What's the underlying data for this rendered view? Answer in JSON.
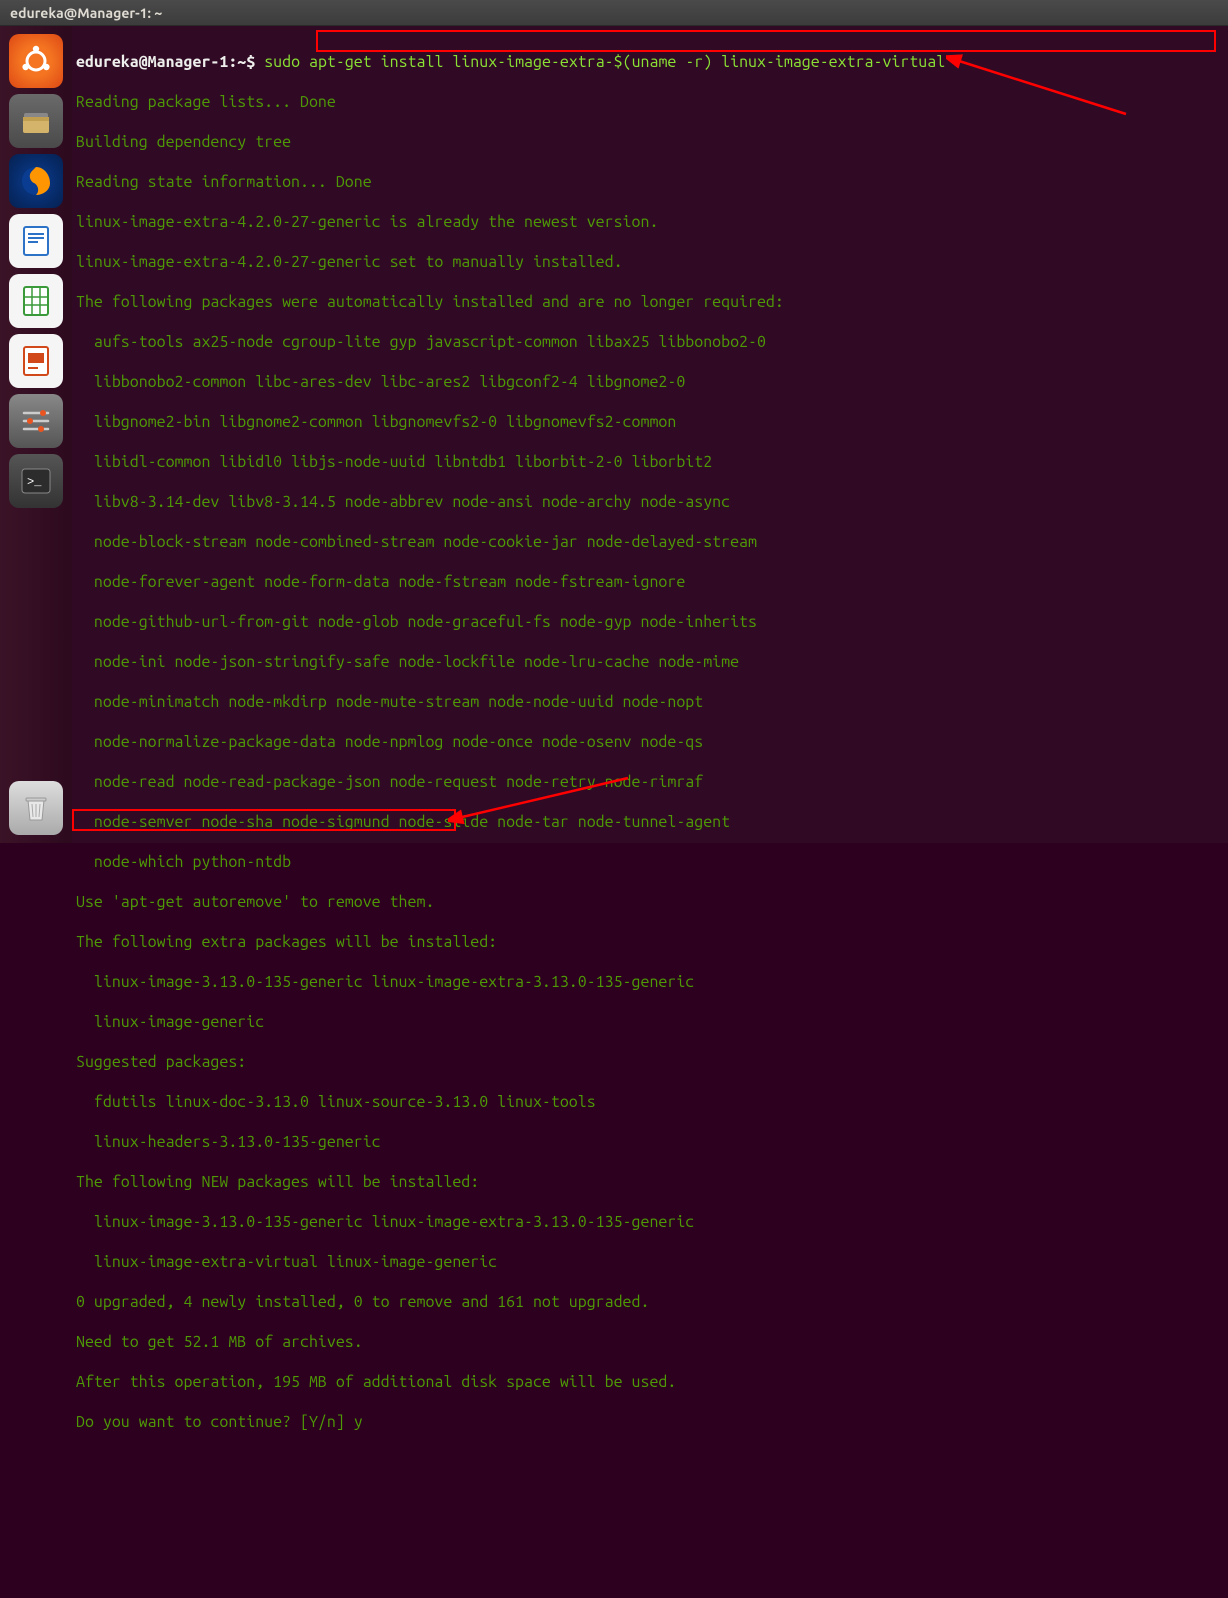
{
  "window": {
    "title": "edureka@Manager-1: ~"
  },
  "launcher": {
    "items": [
      {
        "name": "ubuntu-dash"
      },
      {
        "name": "files"
      },
      {
        "name": "firefox"
      },
      {
        "name": "libreoffice-writer"
      },
      {
        "name": "libreoffice-calc"
      },
      {
        "name": "libreoffice-impress"
      },
      {
        "name": "system-settings"
      },
      {
        "name": "terminal"
      },
      {
        "name": "trash"
      }
    ]
  },
  "terminal": {
    "prompt_user_host": "edureka@Manager-1",
    "prompt_path": "~",
    "prompt_sep": ":",
    "prompt_dollar": "$",
    "command": "sudo apt-get install linux-image-extra-$(uname -r) linux-image-extra-virtual",
    "lines": [
      "Reading package lists... Done",
      "Building dependency tree",
      "Reading state information... Done",
      "linux-image-extra-4.2.0-27-generic is already the newest version.",
      "linux-image-extra-4.2.0-27-generic set to manually installed.",
      "The following packages were automatically installed and are no longer required:",
      "  aufs-tools ax25-node cgroup-lite gyp javascript-common libax25 libbonobo2-0",
      "  libbonobo2-common libc-ares-dev libc-ares2 libgconf2-4 libgnome2-0",
      "  libgnome2-bin libgnome2-common libgnomevfs2-0 libgnomevfs2-common",
      "  libidl-common libidl0 libjs-node-uuid libntdb1 liborbit-2-0 liborbit2",
      "  libv8-3.14-dev libv8-3.14.5 node-abbrev node-ansi node-archy node-async",
      "  node-block-stream node-combined-stream node-cookie-jar node-delayed-stream",
      "  node-forever-agent node-form-data node-fstream node-fstream-ignore",
      "  node-github-url-from-git node-glob node-graceful-fs node-gyp node-inherits",
      "  node-ini node-json-stringify-safe node-lockfile node-lru-cache node-mime",
      "  node-minimatch node-mkdirp node-mute-stream node-node-uuid node-nopt",
      "  node-normalize-package-data node-npmlog node-once node-osenv node-qs",
      "  node-read node-read-package-json node-request node-retry node-rimraf",
      "  node-semver node-sha node-sigmund node-slide node-tar node-tunnel-agent",
      "  node-which python-ntdb",
      "Use 'apt-get autoremove' to remove them.",
      "The following extra packages will be installed:",
      "  linux-image-3.13.0-135-generic linux-image-extra-3.13.0-135-generic",
      "  linux-image-generic",
      "Suggested packages:",
      "  fdutils linux-doc-3.13.0 linux-source-3.13.0 linux-tools",
      "  linux-headers-3.13.0-135-generic",
      "The following NEW packages will be installed:",
      "  linux-image-3.13.0-135-generic linux-image-extra-3.13.0-135-generic",
      "  linux-image-extra-virtual linux-image-generic",
      "0 upgraded, 4 newly installed, 0 to remove and 161 not upgraded.",
      "Need to get 52.1 MB of archives.",
      "After this operation, 195 MB of additional disk space will be used.",
      "Do you want to continue? [Y/n] y"
    ]
  },
  "annotations": {
    "highlight_command": true,
    "highlight_prompt_answer": true
  }
}
